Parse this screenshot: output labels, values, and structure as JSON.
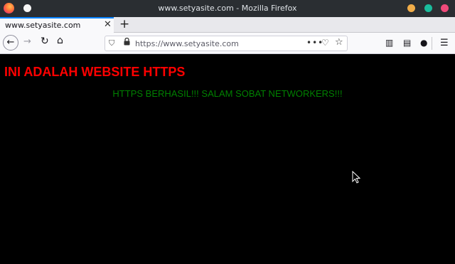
{
  "window": {
    "title": "www.setyasite.com - Mozilla Firefox"
  },
  "tabs": [
    {
      "label": "www.setyasite.com",
      "active": true
    }
  ],
  "toolbar": {
    "new_tab_label": "+",
    "url": "https://www.setyasite.com",
    "icons": [
      "back-arrow-icon",
      "forward-arrow-icon",
      "reload-icon",
      "home-icon",
      "shield-icon",
      "lock-icon",
      "more-actions-icon",
      "pocket-icon",
      "bookmark-star-icon",
      "library-icon",
      "sidebar-icon",
      "account-icon",
      "hamburger-menu-icon"
    ]
  },
  "page": {
    "heading": "INI ADALAH WEBSITE HTTPS",
    "message": "HTTPS BERHASIL!!! SALAM SOBAT NETWORKERS!!!"
  },
  "colors": {
    "heading": "#ff0000",
    "message": "#008000",
    "background": "#000000",
    "titlebar": "#2a2e32",
    "accent": "#0a84ff"
  }
}
